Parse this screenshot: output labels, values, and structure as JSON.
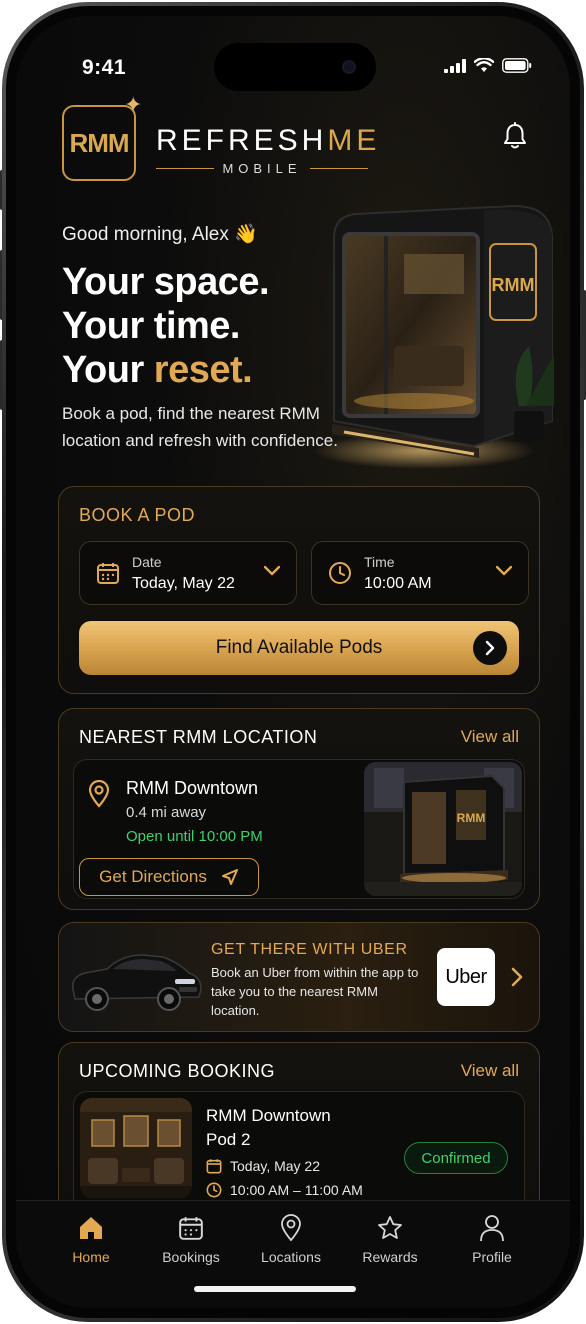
{
  "status": {
    "time": "9:41"
  },
  "brand": {
    "logo_text": "RMM",
    "name_white": "REFRESH",
    "name_gold": "ME",
    "sub": "MOBILE"
  },
  "hero": {
    "greeting": "Good morning, Alex 👋",
    "line1": "Your space.",
    "line2": "Your time.",
    "line3_white": "Your ",
    "line3_gold": "reset.",
    "subtitle": "Book a pod, find the nearest RMM location and refresh with confidence.",
    "pod_sign": "RMM"
  },
  "book": {
    "title": "BOOK A POD",
    "date_label": "Date",
    "date_value": "Today, May 22",
    "time_label": "Time",
    "time_value": "10:00 AM",
    "cta": "Find Available Pods"
  },
  "nearest": {
    "title": "NEAREST RMM LOCATION",
    "view_all": "View all",
    "name": "RMM Downtown",
    "distance": "0.4 mi away",
    "hours": "Open until 10:00 PM",
    "directions": "Get Directions"
  },
  "uber": {
    "title": "GET THERE WITH UBER",
    "description": "Book an Uber from within the app to take you to the nearest RMM location.",
    "logo": "Uber"
  },
  "upcoming": {
    "title": "UPCOMING BOOKING",
    "view_all": "View all",
    "location": "RMM Downtown",
    "pod": "Pod 2",
    "date": "Today, May 22",
    "time": "10:00 AM – 11:00 AM",
    "status": "Confirmed"
  },
  "tabs": [
    {
      "label": "Home",
      "icon": "home-icon",
      "active": true
    },
    {
      "label": "Bookings",
      "icon": "calendar-icon",
      "active": false
    },
    {
      "label": "Locations",
      "icon": "location-pin-icon",
      "active": false
    },
    {
      "label": "Rewards",
      "icon": "star-icon",
      "active": false
    },
    {
      "label": "Profile",
      "icon": "user-icon",
      "active": false
    }
  ],
  "colors": {
    "gold": "#e2a953",
    "green": "#3ed16a",
    "background": "#0c0c0c"
  }
}
